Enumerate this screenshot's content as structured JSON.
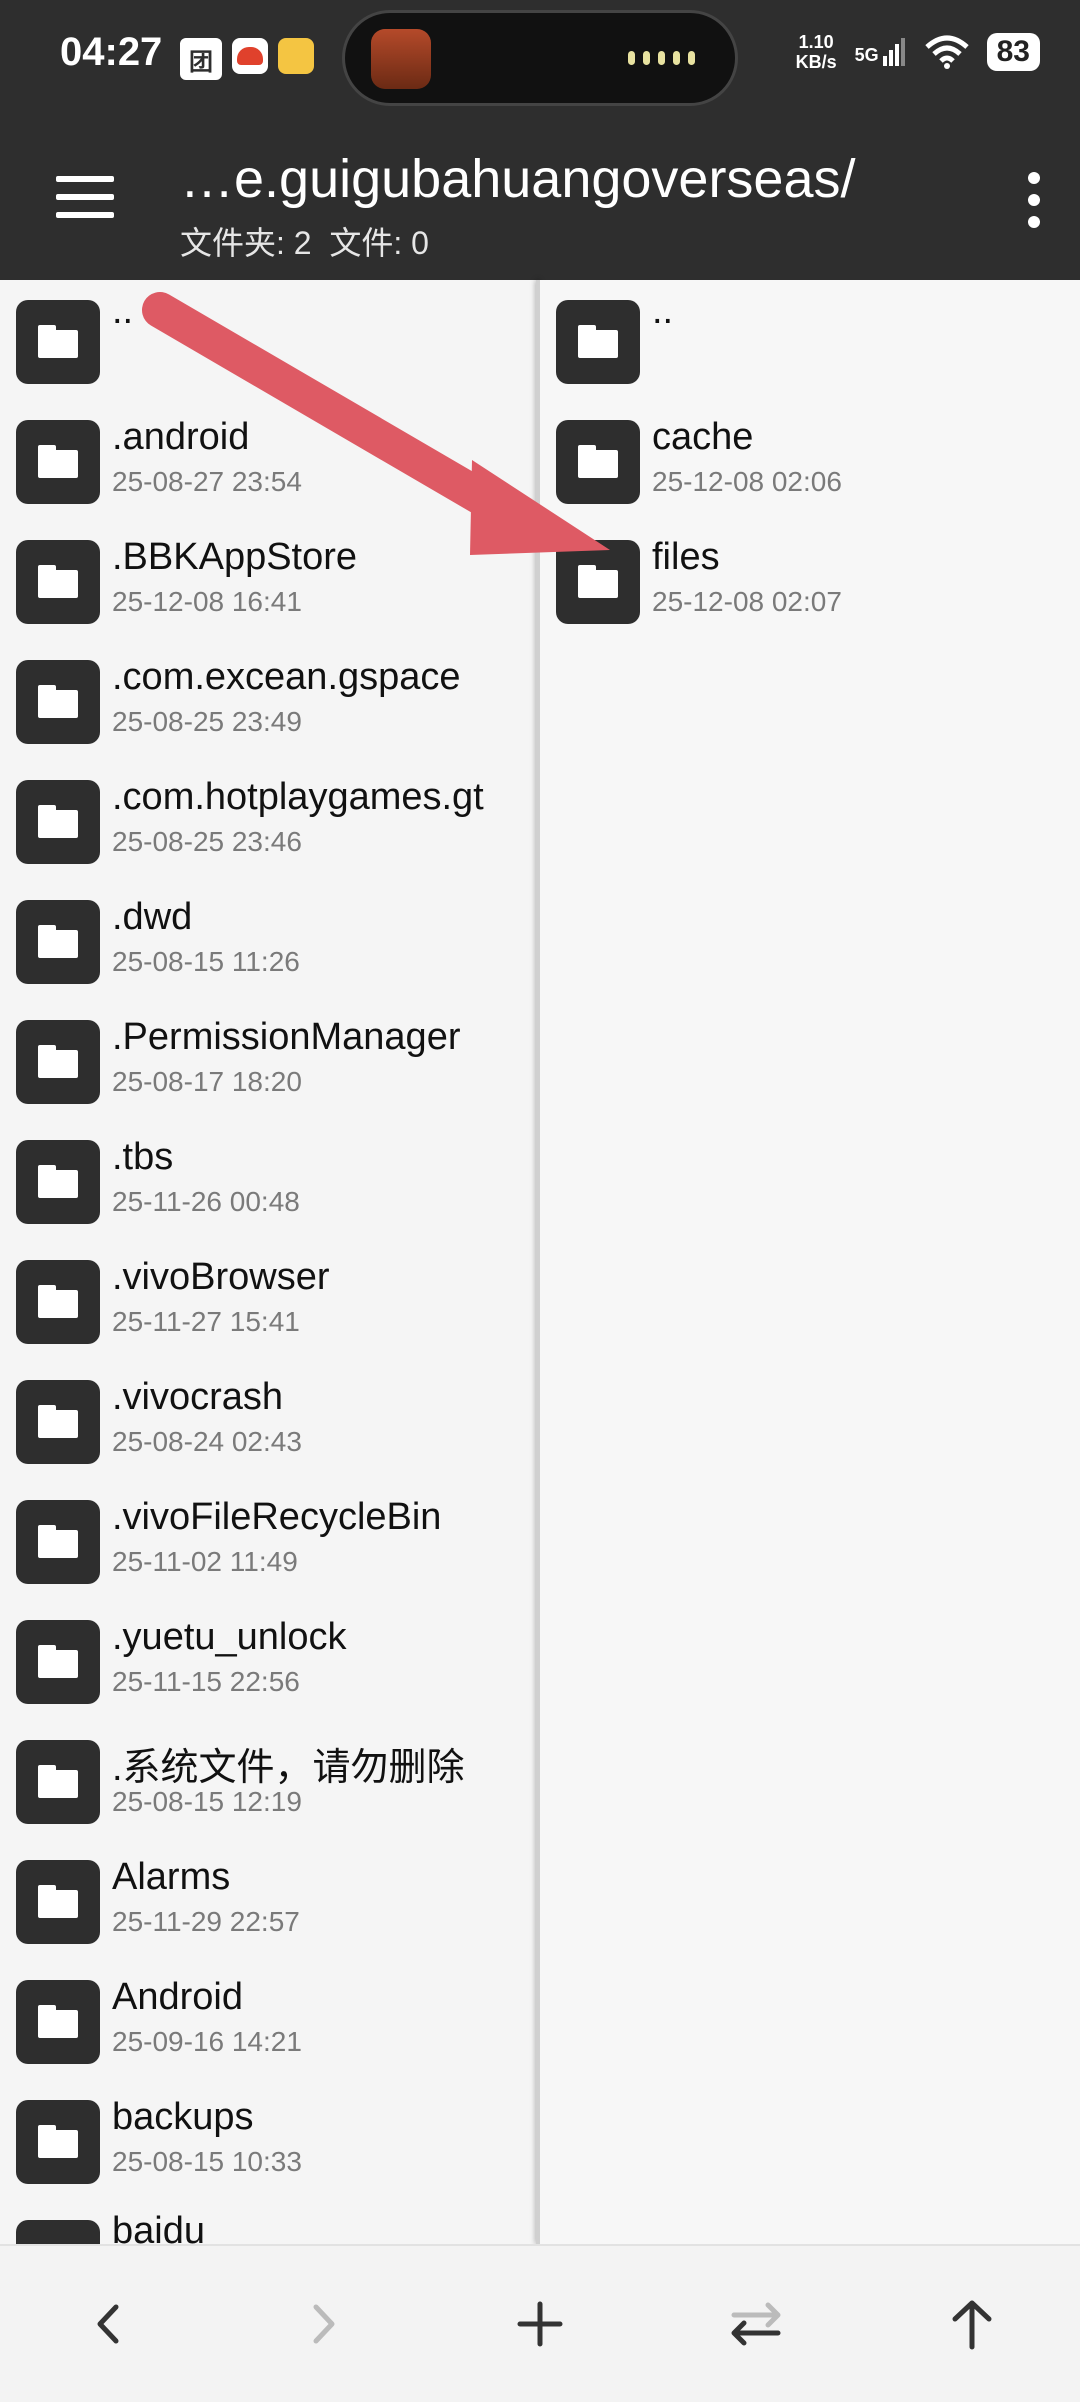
{
  "status": {
    "time": "04:27",
    "net_speed_value": "1.10",
    "net_speed_unit": "KB/s",
    "signal": "5G",
    "battery": "83",
    "left_icons": [
      "meituan-icon",
      "app-icon-red",
      "notes-icon"
    ]
  },
  "appbar": {
    "title": "…e.guigubahuangoverseas/",
    "subtitle": "文件夹: 2  文件: 0"
  },
  "left_pane": {
    "items": [
      {
        "name": "..",
        "date": ""
      },
      {
        "name": ".android",
        "date": "25-08-27 23:54"
      },
      {
        "name": ".BBKAppStore",
        "date": "25-12-08 16:41"
      },
      {
        "name": ".com.excean.gspace",
        "date": "25-08-25 23:49"
      },
      {
        "name": ".com.hotplaygames.gt",
        "date": "25-08-25 23:46"
      },
      {
        "name": ".dwd",
        "date": "25-08-15 11:26"
      },
      {
        "name": ".PermissionManager",
        "date": "25-08-17 18:20"
      },
      {
        "name": ".tbs",
        "date": "25-11-26 00:48"
      },
      {
        "name": ".vivoBrowser",
        "date": "25-11-27 15:41"
      },
      {
        "name": ".vivocrash",
        "date": "25-08-24 02:43"
      },
      {
        "name": ".vivoFileRecycleBin",
        "date": "25-11-02 11:49"
      },
      {
        "name": ".yuetu_unlock",
        "date": "25-11-15 22:56"
      },
      {
        "name": ".系统文件，请勿删除",
        "date": "25-08-15 12:19"
      },
      {
        "name": "Alarms",
        "date": "25-11-29 22:57"
      },
      {
        "name": "Android",
        "date": "25-09-16 14:21"
      },
      {
        "name": "backups",
        "date": "25-08-15 10:33"
      },
      {
        "name": "baidu",
        "date": ""
      }
    ]
  },
  "right_pane": {
    "items": [
      {
        "name": "..",
        "date": ""
      },
      {
        "name": "cache",
        "date": "25-12-08 02:06"
      },
      {
        "name": "files",
        "date": "25-12-08 02:07"
      }
    ]
  },
  "annotation": {
    "arrow_color": "#de5a64"
  },
  "bottombar": {
    "buttons": [
      "back-icon",
      "forward-icon",
      "add-icon",
      "swap-panes-icon",
      "up-icon"
    ]
  }
}
